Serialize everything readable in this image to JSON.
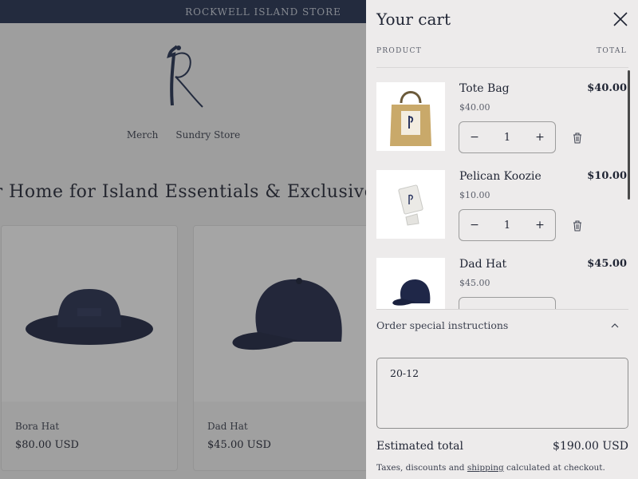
{
  "store": {
    "announcement": "ROCKWELL ISLAND STORE",
    "nav": [
      "Merch",
      "Sundry Store"
    ],
    "headline": "ur Home for Island Essentials & Exclusive G",
    "products": [
      {
        "title": "Bora Hat",
        "price": "$80.00 USD"
      },
      {
        "title": "Dad Hat",
        "price": "$45.00 USD"
      }
    ],
    "accent_color": "#1f2d4f"
  },
  "cart": {
    "title": "Your cart",
    "columns": {
      "product": "PRODUCT",
      "total": "TOTAL"
    },
    "items": [
      {
        "name": "Tote Bag",
        "unit_price": "$40.00",
        "total": "$40.00",
        "quantity": "1"
      },
      {
        "name": "Pelican Koozie",
        "unit_price": "$10.00",
        "total": "$10.00",
        "quantity": "1"
      },
      {
        "name": "Dad Hat",
        "unit_price": "$45.00",
        "total": "$45.00",
        "quantity": ""
      }
    ],
    "instructions_label": "Order special instructions",
    "instructions_value": "20-12",
    "estimated_total_label": "Estimated total",
    "estimated_total_value": "$190.00 USD",
    "tax_note_before": "Taxes, discounts and",
    "tax_note_link": "shipping",
    "tax_note_after": "calculated at checkout.",
    "icons": {
      "close": "close-icon",
      "minus": "minus-icon",
      "plus": "plus-icon",
      "remove": "trash-icon",
      "collapse": "chevron-up-icon"
    }
  }
}
